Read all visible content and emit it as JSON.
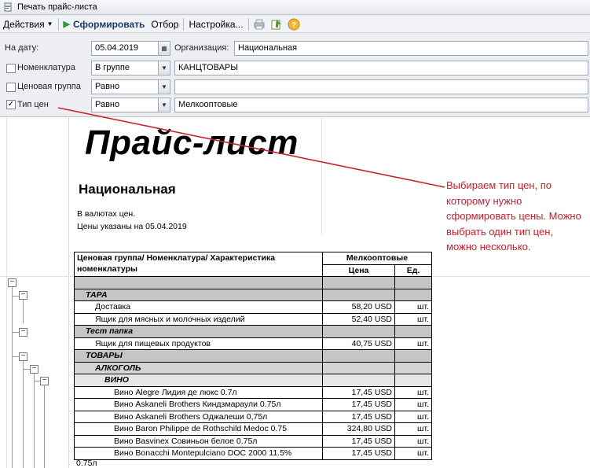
{
  "window": {
    "title": "Печать прайс-листа"
  },
  "toolbar": {
    "actions": "Действия",
    "generate": "Сформировать",
    "filter": "Отбор",
    "settings": "Настройка..."
  },
  "form": {
    "date_label": "На дату:",
    "date_value": "05.04.2019",
    "org_label": "Организация:",
    "org_value": "Национальная",
    "nomenclature": {
      "label": "Номенклатура",
      "checked": false,
      "condition": "В группе",
      "value": "КАНЦТОВАРЫ"
    },
    "price_group": {
      "label": "Ценовая группа",
      "checked": false,
      "condition": "Равно",
      "value": ""
    },
    "price_type": {
      "label": "Тип цен",
      "checked": true,
      "check_mark": "✓",
      "condition": "Равно",
      "value": "Мелкооптовые"
    }
  },
  "report": {
    "title": "Прайс-лист",
    "org": "Национальная",
    "note1": "В валютах цен.",
    "note2": "Цены указаны на 05.04.2019",
    "col_header": "Ценовая группа/ Номенклатура/ Характеристика номенклатуры",
    "price_type_header": "Мелкооптовые",
    "price_header": "Цена",
    "unit_header": "Ед.",
    "rows": [
      {
        "type": "group",
        "name": "ТАРА"
      },
      {
        "type": "item",
        "name": "Доставка",
        "price": "58,20 USD",
        "unit": "шт."
      },
      {
        "type": "item",
        "name": "Ящик для мясных и молочных изделий",
        "price": "52,40 USD",
        "unit": "шт."
      },
      {
        "type": "group",
        "name": "Тест папка"
      },
      {
        "type": "item",
        "name": "Ящик для пищевых продуктов",
        "price": "40,75 USD",
        "unit": "шт."
      },
      {
        "type": "group",
        "name": "ТОВАРЫ"
      },
      {
        "type": "group2",
        "name": "АЛКОГОЛЬ"
      },
      {
        "type": "group3",
        "name": "ВИНО"
      },
      {
        "type": "item2",
        "name": "Вино Alegre Лидия де люкс 0.7л",
        "price": "17,45 USD",
        "unit": "шт."
      },
      {
        "type": "item2",
        "name": "Вино Askaneli Brothers Киндзмараули 0.75л",
        "price": "17,45 USD",
        "unit": "шт."
      },
      {
        "type": "item2",
        "name": "Вино Askaneli Brothers Оджалеши 0,75л",
        "price": "17,45 USD",
        "unit": "шт."
      },
      {
        "type": "item2",
        "name": "Вино Baron Philippe de Rothschild Medoc 0.75",
        "price": "324,80 USD",
        "unit": "шт."
      },
      {
        "type": "item2",
        "name": "Вино Basvinex Совиньон белое 0.75л",
        "price": "17,45 USD",
        "unit": "шт."
      },
      {
        "type": "item2",
        "name": "Вино Bonacchi Montepulciano DOC 2000 11.5%",
        "price": "17,45 USD",
        "unit": "шт."
      }
    ],
    "wrap_tail": "0.75л"
  },
  "annotation": "Выбираем тип цен, по которому нужно сформировать цены. Можно выбрать один тип цен, можно несколько.",
  "colors": {
    "annotation": "#c8212e",
    "group_bg": "#c5c5c5"
  }
}
